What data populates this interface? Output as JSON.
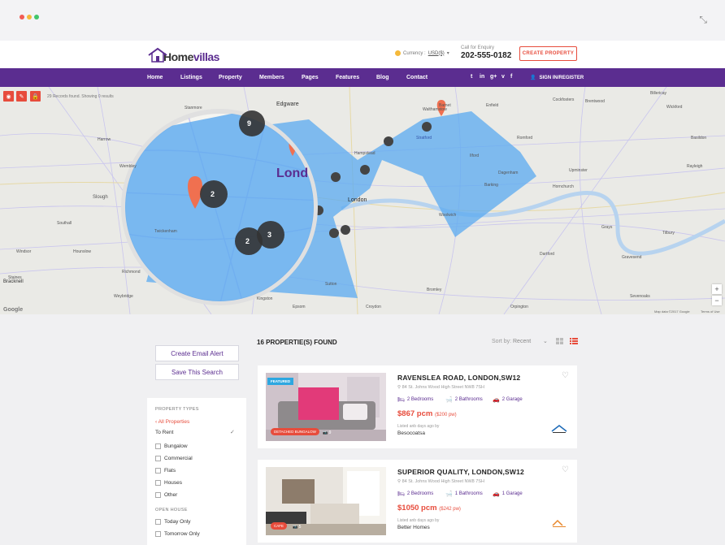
{
  "header": {
    "logo_home": "Home",
    "logo_villas": "villas",
    "currency_label": "Currency :",
    "currency_value": "USD($)",
    "enquiry_label": "Call for Enquiry",
    "phone": "202-555-0182",
    "create_property": "CREATE PROPERTY"
  },
  "nav": {
    "items": [
      "Home",
      "Listings",
      "Property",
      "Members",
      "Pages",
      "Features",
      "Blog",
      "Contact"
    ],
    "social": [
      "t",
      "in",
      "g+",
      "v",
      "f"
    ],
    "signin": "SIGN IN/REGISTER"
  },
  "map": {
    "records": "29 Records found. Showing 0 results",
    "big_label": "Lond",
    "center_label": "London",
    "clusters": [
      "9",
      "2",
      "2",
      "3"
    ],
    "labels": [
      "Edgware",
      "Barnet",
      "Enfield",
      "Cockfosters",
      "Stanmore",
      "Harrow",
      "Wembley",
      "Southall",
      "Slough",
      "Hounslow",
      "Richmond",
      "Kingston",
      "Epsom",
      "Bromley",
      "Croydon",
      "Orpington",
      "Dartford",
      "Romford",
      "Ilford",
      "Brentwood",
      "Basildon",
      "Grays",
      "Billericay",
      "Upminster",
      "Hornchurch",
      "Woolwich",
      "Barking",
      "Dagenham",
      "Sutton",
      "Windsor",
      "Staines",
      "Twickenham",
      "Weybridge",
      "Bracknell",
      "Sevenoaks",
      "Gravesend",
      "Wickford",
      "Rayleigh",
      "Tilbury",
      "Stratford",
      "Hampstead",
      "Walthamstow"
    ],
    "attribution": "Map data ©2017 Google",
    "terms": "Terms of Use",
    "google": "Google"
  },
  "sidebar": {
    "email_alert": "Create Email Alert",
    "save_search": "Save This Search",
    "property_types_heading": "PROPERTY TYPES",
    "all_properties": "All Properties",
    "to_rent": "To Rent",
    "types": [
      "Bungalow",
      "Commercial",
      "Flats",
      "Houses",
      "Other"
    ],
    "open_house_heading": "OPEN HOUSE",
    "open_house": [
      "Today Only",
      "Tomorrow Only"
    ]
  },
  "results": {
    "found": "16 PROPERTIE(S) FOUND",
    "sort_label": "Sort by:",
    "sort_value": "Recent"
  },
  "listings": [
    {
      "featured": "FEATURED",
      "tag": "DETACHED BUNGALOW",
      "photo_count": "9",
      "title": "RAVENSLEA ROAD, LONDON,SW12",
      "address": "84 St. Johns Wood High Street NW8 7SH",
      "bedrooms": "2 Bedrooms",
      "bathrooms": "2 Bathrooms",
      "garage": "2 Garage",
      "price": "$867 pcm",
      "price_per": "($200 pw)",
      "listed": "Listed anb days ago by",
      "agent": "Besocoatsa"
    },
    {
      "tag": "CAFE",
      "photo_count": "5",
      "title": "SUPERIOR QUALITY, LONDON,SW12",
      "address": "84 St. Johns Wood High Street NW8 7SH",
      "bedrooms": "2 Bedrooms",
      "bathrooms": "1 Bathrooms",
      "garage": "1 Garage",
      "price": "$1050 pcm",
      "price_per": "($242 pw)",
      "listed": "Listed anb days ago by",
      "agent": "Better Homes"
    }
  ],
  "colors": {
    "brand": "#5b2d90",
    "accent": "#e74c3c",
    "map_polygon": "#5aa9f0"
  }
}
